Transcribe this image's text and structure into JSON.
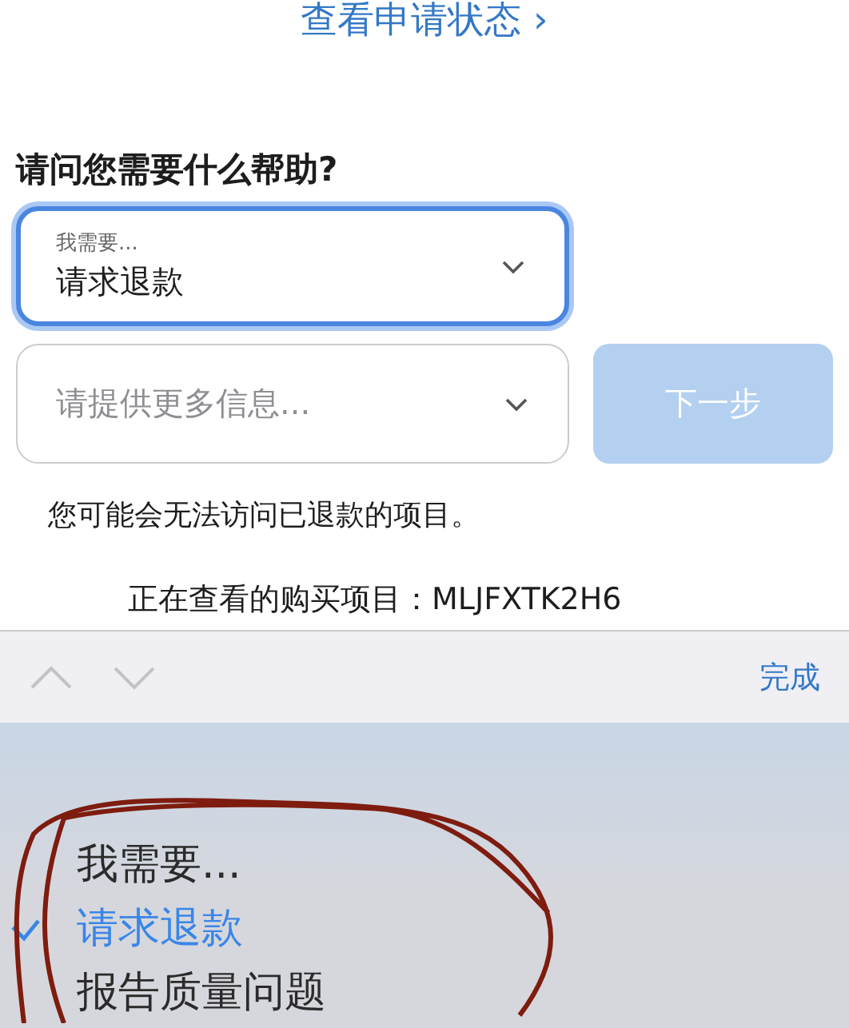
{
  "status_link": "查看申请状态 ›",
  "heading": "请问您需要什么帮助?",
  "request_select": {
    "label": "我需要...",
    "value": "请求退款",
    "focused": true
  },
  "details_select": {
    "placeholder": "请提供更多信息...",
    "focused": false
  },
  "next_button": {
    "label": "下一步",
    "disabled": true
  },
  "note": "您可能会无法访问已退款的项目。",
  "purchase_line": "正在查看的购买项目：MLJFXTK2H6",
  "toolbar": {
    "done": "完成"
  },
  "picker": {
    "options": [
      {
        "label": "我需要...",
        "selected": false
      },
      {
        "label": "请求退款",
        "selected": true
      },
      {
        "label": "报告质量问题",
        "selected": false
      }
    ]
  }
}
